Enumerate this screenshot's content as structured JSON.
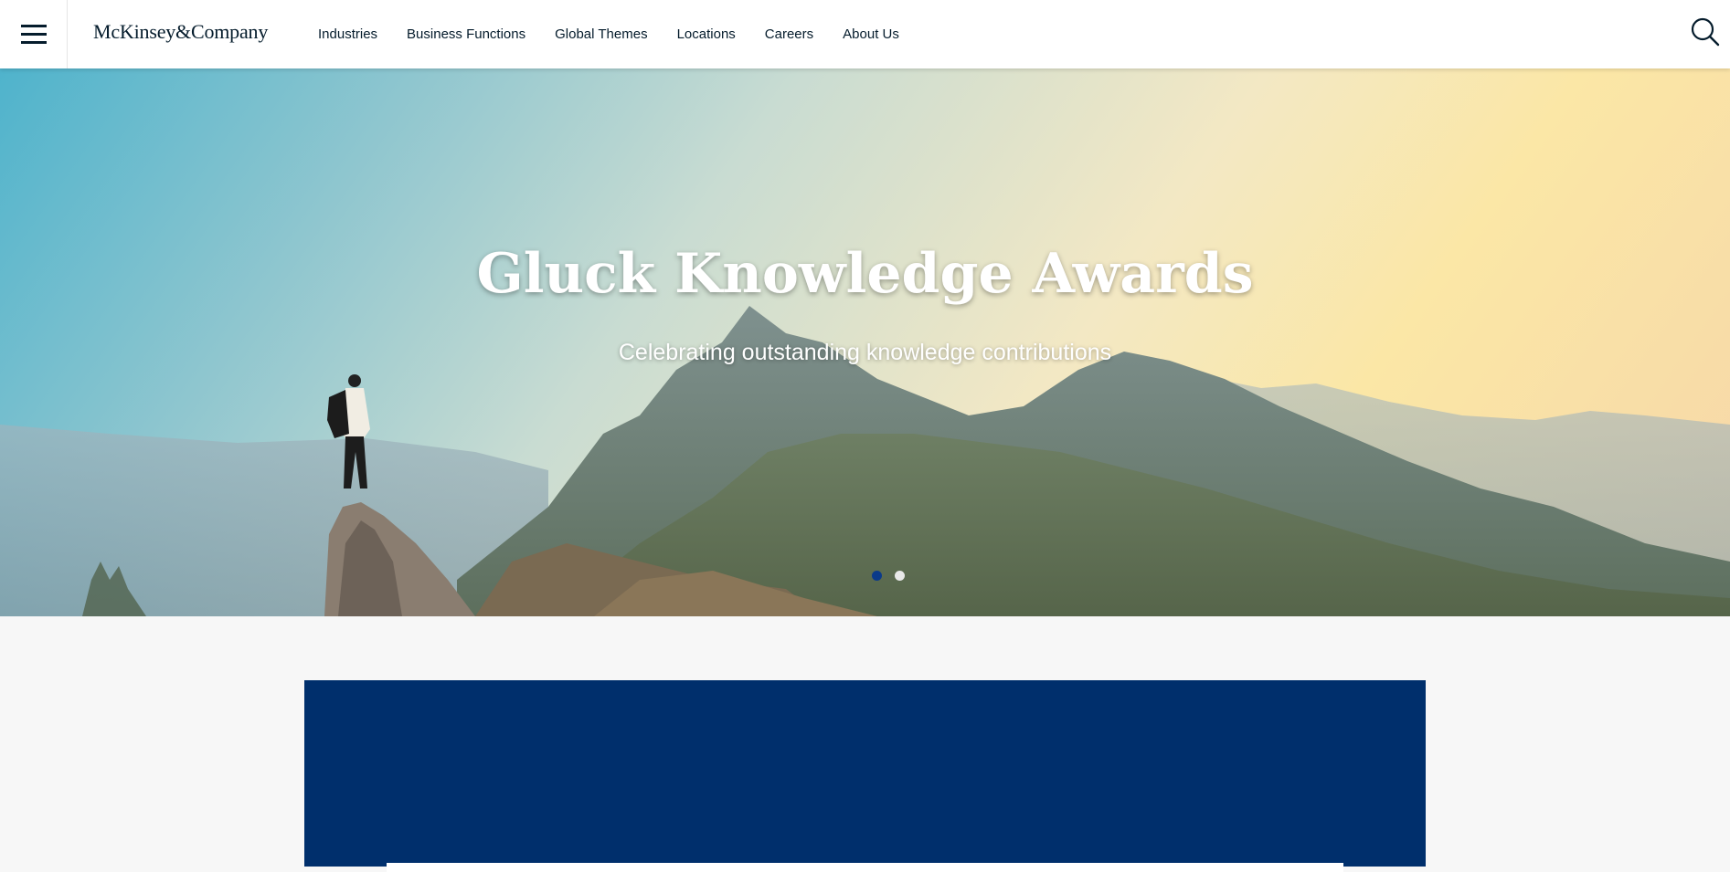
{
  "header": {
    "logo": "McKinsey&Company",
    "nav": [
      "Industries",
      "Business Functions",
      "Global Themes",
      "Locations",
      "Careers",
      "About Us"
    ],
    "icons": {
      "menu": "hamburger-menu-icon",
      "search": "search-icon"
    }
  },
  "hero": {
    "title": "Gluck Knowledge Awards",
    "subtitle": "Celebrating outstanding knowledge contributions",
    "carousel": {
      "slides": 2,
      "active": 1
    }
  },
  "colors": {
    "navy": "#051c2c",
    "brand_blue": "#002f6c",
    "active_dot": "#0b3a8a",
    "page_bg": "#f7f7f7"
  }
}
